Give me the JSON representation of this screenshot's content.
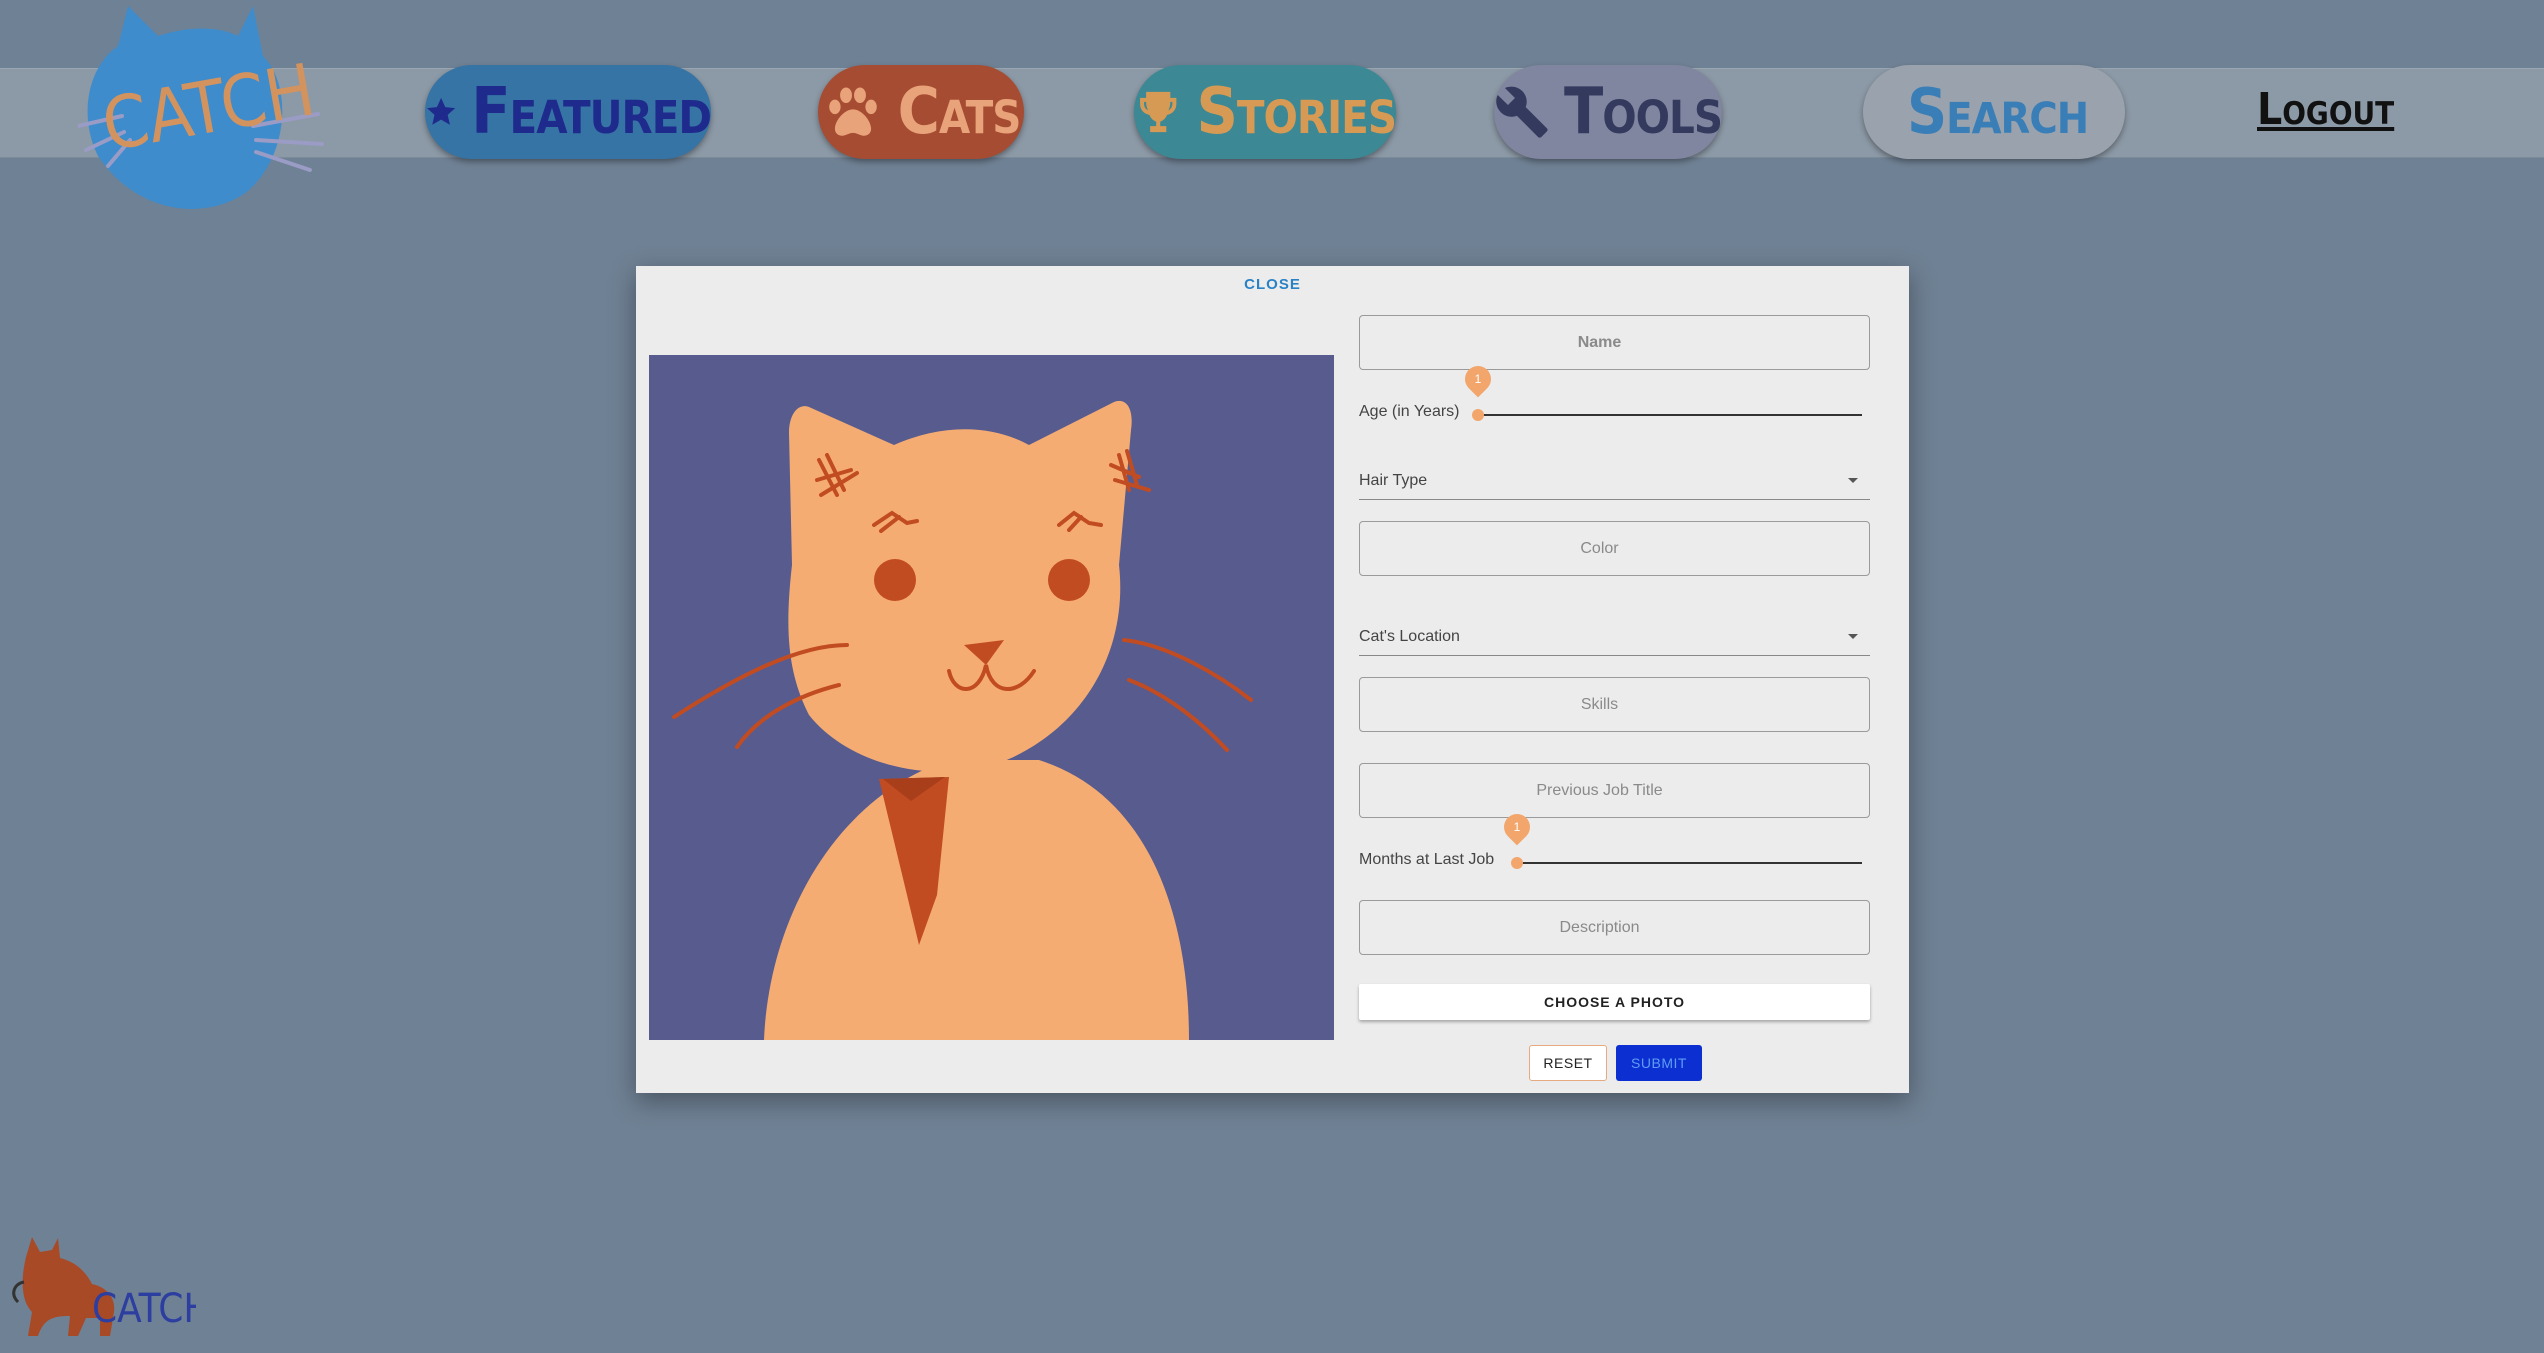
{
  "brand": {
    "logo_text": "CATCH",
    "footer_logo_text": "CATCH"
  },
  "nav": {
    "featured": {
      "label": "Featured",
      "icon": "star-icon"
    },
    "cats": {
      "label": "Cats",
      "icon": "paw-icon"
    },
    "stories": {
      "label": "Stories",
      "icon": "trophy-icon"
    },
    "tools": {
      "label": "Tools",
      "icon": "wrench-icon"
    },
    "search": {
      "label": "Search",
      "icon": "search-icon"
    },
    "logout": {
      "label": "Logout"
    }
  },
  "modal": {
    "close_label": "CLOSE",
    "name_placeholder": "Name",
    "age": {
      "label": "Age (in Years)",
      "value": "1",
      "fraction": 0
    },
    "hair_type_label": "Hair Type",
    "color_placeholder": "Color",
    "location_label": "Cat's Location",
    "skills_placeholder": "Skills",
    "previous_job_placeholder": "Previous Job Title",
    "months": {
      "label": "Months at Last Job",
      "value": "1",
      "fraction": 0
    },
    "description_placeholder": "Description",
    "choose_photo_label": "CHOOSE A PHOTO",
    "reset_label": "RESET",
    "submit_label": "SUBMIT"
  },
  "colors": {
    "page_background": "#6f8194",
    "accent_orange": "#f2a66c",
    "submit_blue": "#0b2fd1",
    "link_blue": "#2a82c6"
  }
}
